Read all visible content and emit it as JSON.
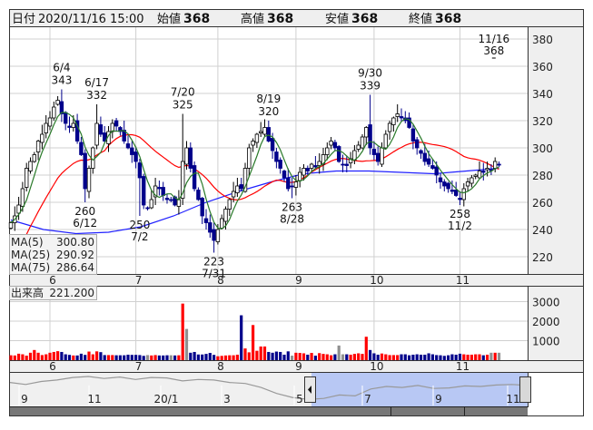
{
  "header": {
    "date_label": "日付",
    "date_value": "2020/11/16 15:00",
    "open_label": "始値",
    "open_value": "368",
    "high_label": "高値",
    "high_value": "368",
    "low_label": "安値",
    "low_value": "368",
    "close_label": "終値",
    "close_value": "368"
  },
  "colors": {
    "up_body": "#ffffff",
    "down_body": "#00008b",
    "ma5": "#2a7a2a",
    "ma25": "#ff0000",
    "ma75": "#2020ff",
    "vol_up": "#ff0000",
    "vol_down": "#00008b",
    "vol_flat": "#909090",
    "high_text": "#ff0000",
    "low_text": "#007000"
  },
  "legend": [
    {
      "label": "MA(5)",
      "value": "300.80"
    },
    {
      "label": "MA(25)",
      "value": "290.92"
    },
    {
      "label": "MA(75)",
      "value": "286.64"
    }
  ],
  "volume_legend": {
    "label": "出来高",
    "value": "221.200"
  },
  "chart_data": {
    "type": "candlestick",
    "price_axis": {
      "ticks": [
        "380",
        "360",
        "340",
        "320",
        "300",
        "280",
        "260",
        "240",
        "220"
      ],
      "ylim": [
        212,
        392
      ]
    },
    "month_ticks": [
      {
        "label": "6",
        "index": 10
      },
      {
        "label": "7",
        "index": 32
      },
      {
        "label": "8",
        "index": 53
      },
      {
        "label": "9",
        "index": 73
      },
      {
        "label": "10",
        "index": 93
      },
      {
        "label": "11",
        "index": 115
      }
    ],
    "closes": [
      245,
      250,
      258,
      270,
      285,
      290,
      295,
      305,
      310,
      318,
      322,
      330,
      335,
      325,
      318,
      315,
      318,
      305,
      295,
      270,
      285,
      300,
      318,
      310,
      305,
      312,
      318,
      316,
      312,
      305,
      300,
      295,
      290,
      278,
      258,
      256,
      262,
      272,
      270,
      265,
      262,
      262,
      258,
      262,
      290,
      300,
      285,
      270,
      262,
      250,
      245,
      238,
      232,
      240,
      248,
      255,
      262,
      268,
      272,
      270,
      285,
      300,
      305,
      310,
      312,
      315,
      305,
      298,
      290,
      285,
      278,
      270,
      272,
      275,
      282,
      285,
      283,
      288,
      286,
      290,
      295,
      300,
      305,
      300,
      290,
      288,
      287,
      292,
      298,
      302,
      308,
      315,
      300,
      295,
      290,
      300,
      310,
      318,
      322,
      325,
      322,
      320,
      315,
      305,
      300,
      296,
      290,
      288,
      285,
      280,
      275,
      272,
      270,
      268,
      265,
      262,
      270,
      275,
      278,
      280,
      283,
      282,
      285,
      284,
      290,
      288
    ],
    "ma75": [
      247,
      240,
      237,
      238,
      242,
      250,
      260,
      268,
      275,
      281,
      283,
      283,
      282,
      281,
      283,
      285
    ],
    "annotations": [
      {
        "date": "6/4",
        "value": "343",
        "index": 13,
        "kind": "high"
      },
      {
        "date": "6/12",
        "value": "260",
        "index": 19,
        "kind": "low"
      },
      {
        "date": "6/17",
        "value": "332",
        "index": 22,
        "kind": "high"
      },
      {
        "date": "7/2",
        "value": "250",
        "index": 33,
        "kind": "low"
      },
      {
        "date": "7/20",
        "value": "325",
        "index": 44,
        "kind": "high"
      },
      {
        "date": "7/31",
        "value": "223",
        "index": 52,
        "kind": "low"
      },
      {
        "date": "8/19",
        "value": "320",
        "index": 66,
        "kind": "high"
      },
      {
        "date": "8/28",
        "value": "263",
        "index": 72,
        "kind": "low"
      },
      {
        "date": "9/30",
        "value": "339",
        "index": 92,
        "kind": "high"
      },
      {
        "date": "11/2",
        "value": "258",
        "index": 115,
        "kind": "low"
      },
      {
        "date": "11/16",
        "value": "368",
        "index": 126,
        "kind": "last"
      }
    ],
    "volume_axis": {
      "ticks": [
        "3000",
        "2000",
        "1000"
      ],
      "ylim": [
        0,
        3600
      ]
    },
    "volumes": [
      250,
      240,
      330,
      300,
      230,
      380,
      520,
      380,
      260,
      300,
      380,
      420,
      460,
      420,
      300,
      270,
      240,
      240,
      330,
      270,
      440,
      300,
      450,
      410,
      260,
      260,
      260,
      250,
      250,
      250,
      280,
      270,
      270,
      260,
      220,
      260,
      240,
      260,
      240,
      240,
      250,
      250,
      240,
      250,
      2900,
      1600,
      380,
      420,
      290,
      290,
      320,
      370,
      270,
      200,
      220,
      240,
      250,
      250,
      280,
      2300,
      600,
      400,
      1800,
      480,
      700,
      700,
      420,
      380,
      440,
      420,
      280,
      450,
      230,
      380,
      370,
      350,
      280,
      370,
      230,
      360,
      320,
      300,
      250,
      300,
      750,
      300,
      300,
      280,
      320,
      350,
      320,
      1200,
      520,
      350,
      280,
      340,
      300,
      260,
      260,
      260,
      300,
      300,
      250,
      280,
      300,
      280,
      280,
      350,
      300,
      260,
      250,
      220,
      250,
      300,
      280,
      330,
      300,
      280,
      280,
      300,
      300,
      250,
      280,
      380,
      380,
      380
    ]
  },
  "navigator": {
    "labels": [
      "9",
      "11",
      "20/1",
      "3",
      "5",
      "7",
      "9",
      "11"
    ],
    "series": [
      300,
      296,
      302,
      305,
      310,
      312,
      308,
      311,
      306,
      310,
      309,
      303,
      306,
      305,
      300,
      298,
      290,
      278,
      270,
      266,
      268,
      275,
      273,
      287,
      292,
      290,
      294,
      288,
      289,
      293,
      292,
      295,
      296,
      294
    ]
  }
}
